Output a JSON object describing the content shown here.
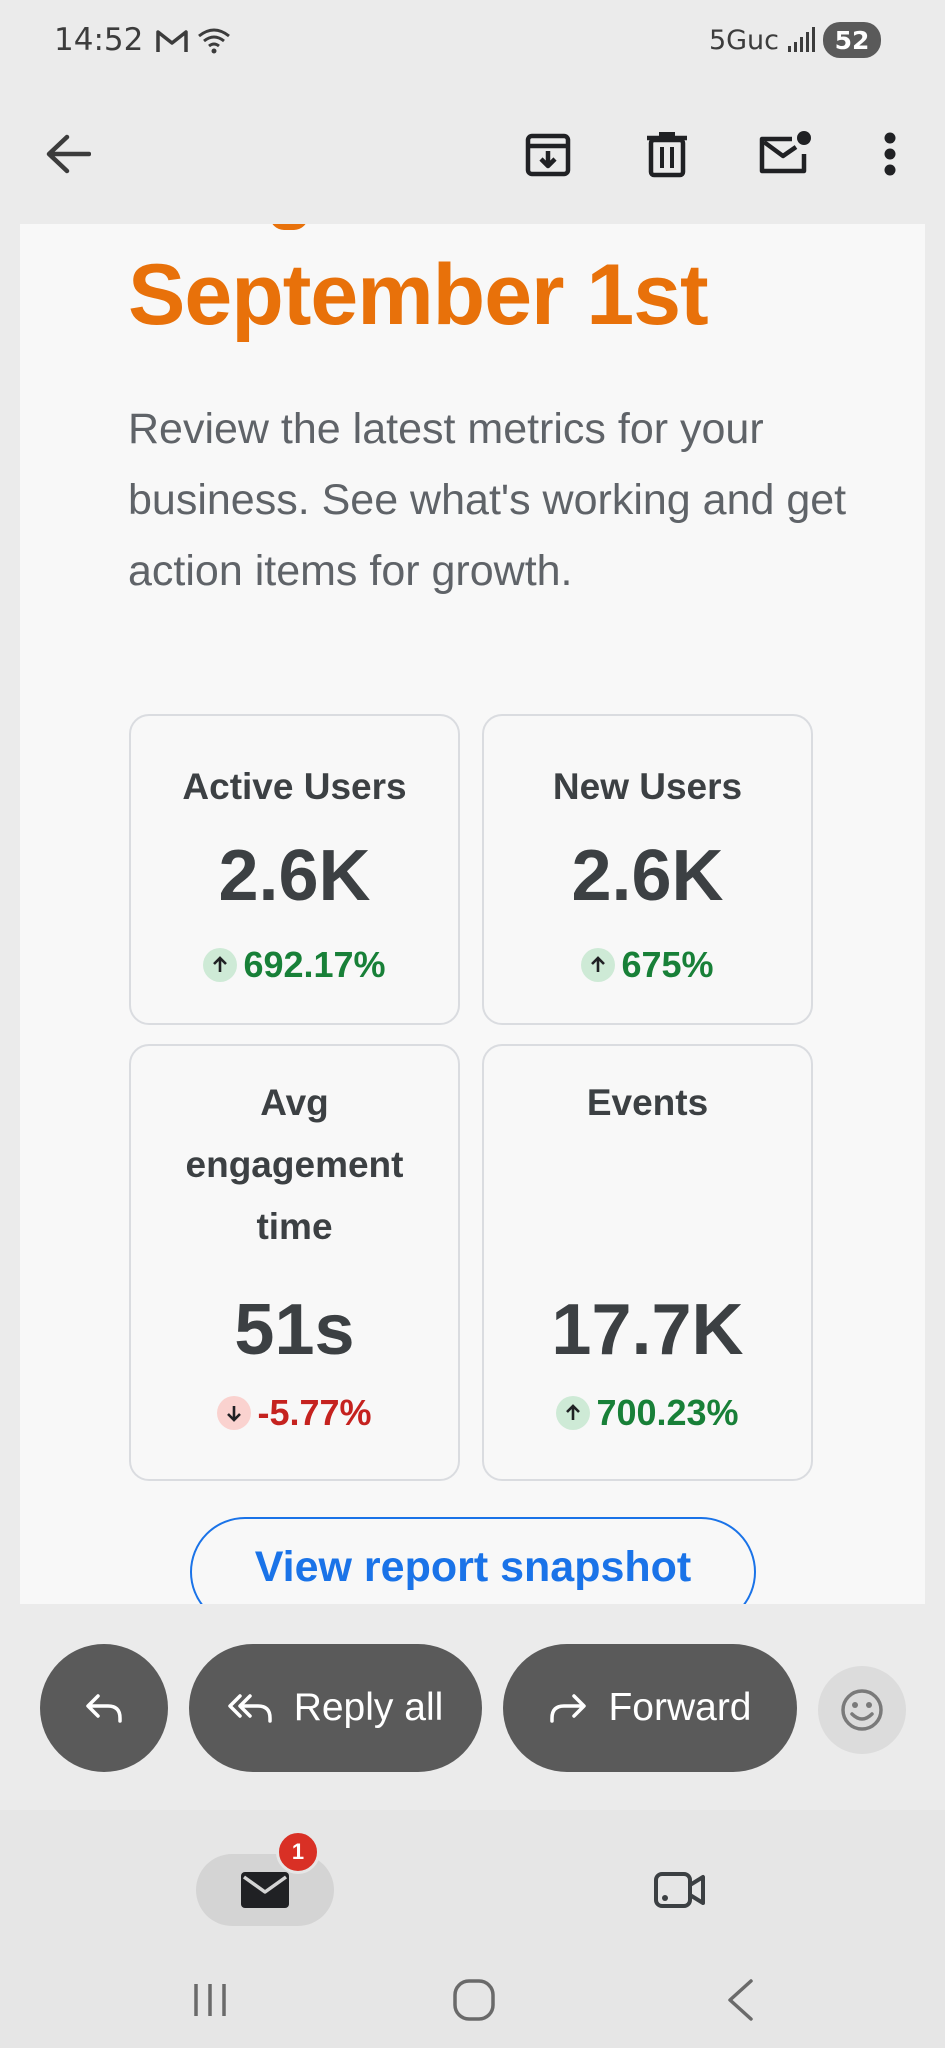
{
  "status_bar": {
    "time": "14:52",
    "network": "5Guc",
    "battery": "52"
  },
  "toolbar": {
    "back_icon": "arrow-back-icon",
    "archive_icon": "archive-icon",
    "delete_icon": "delete-icon",
    "mark_unread_icon": "mark-unread-icon",
    "more_icon": "more-vert-icon"
  },
  "email": {
    "headline": "September 1st",
    "intro": "Review the latest metrics for your business. See what's working and get action items for growth.",
    "metrics": [
      {
        "label": "Active Users",
        "value": "2.6K",
        "change": "692.17%",
        "direction": "up"
      },
      {
        "label": "New Users",
        "value": "2.6K",
        "change": "675%",
        "direction": "up"
      },
      {
        "label": "Avg engagement time",
        "value": "51s",
        "change": "-5.77%",
        "direction": "down"
      },
      {
        "label": "Events",
        "value": "17.7K",
        "change": "700.23%",
        "direction": "up"
      }
    ],
    "snapshot_button": "View report snapshot"
  },
  "reply_bar": {
    "reply_icon": "reply-icon",
    "reply_all_label": "Reply all",
    "forward_label": "Forward",
    "emoji_icon": "emoji-icon"
  },
  "bottom_nav": {
    "mail_badge": "1"
  },
  "colors": {
    "accent_orange": "#e8710a",
    "link_blue": "#1a73e8",
    "positive_green": "#188038",
    "negative_red": "#c5221f"
  }
}
